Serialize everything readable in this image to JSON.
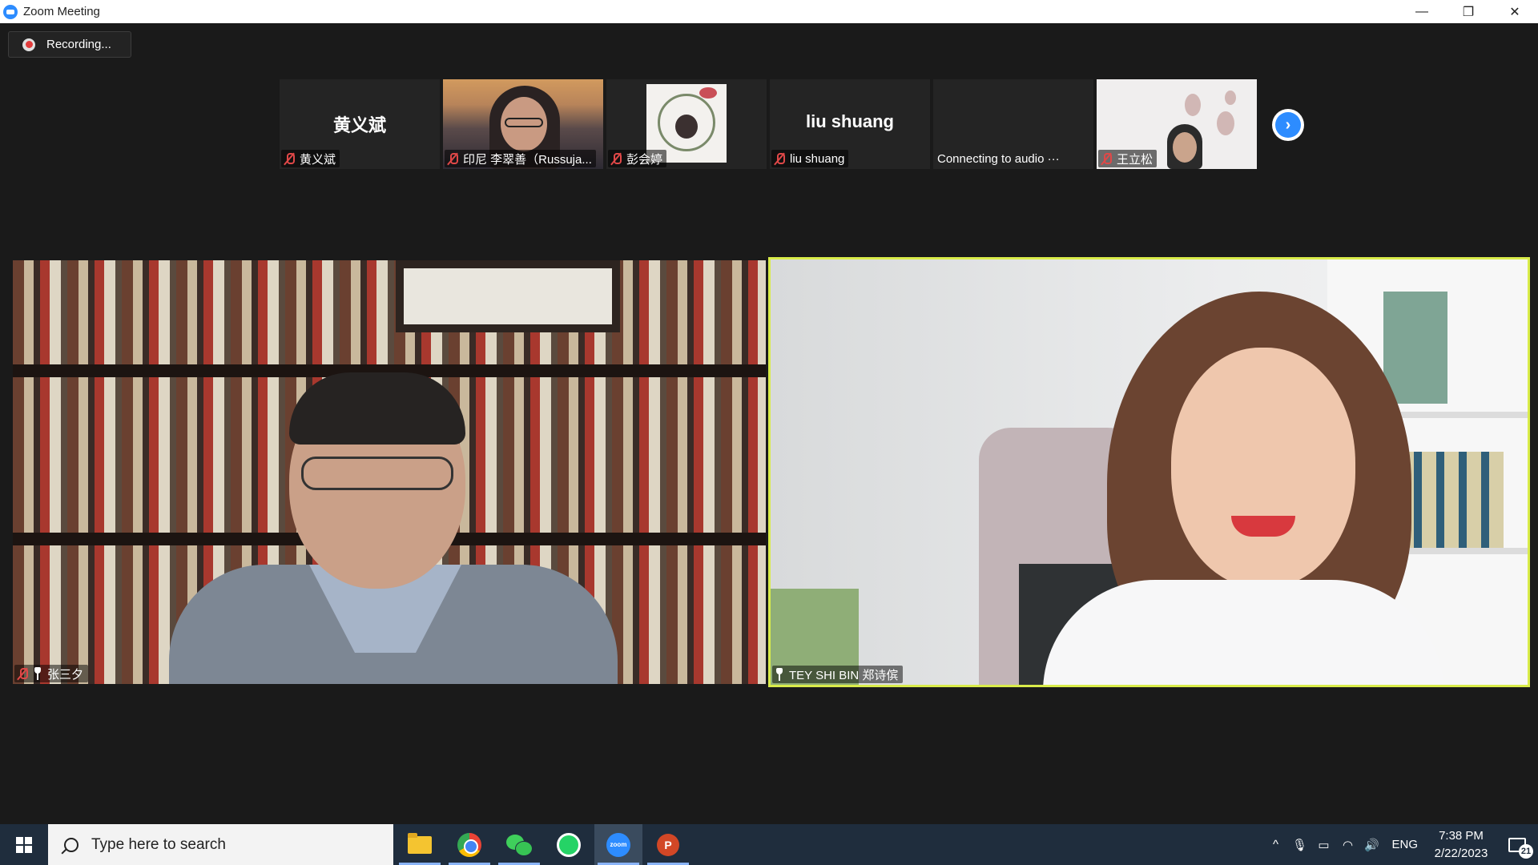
{
  "window": {
    "title": "Zoom Meeting",
    "controls": {
      "minimize": "—",
      "restore": "❐",
      "close": "✕"
    }
  },
  "recording": {
    "label": "Recording..."
  },
  "thumbnails": [
    {
      "big_name": "黄义斌",
      "label": "黄义斌",
      "muted": true,
      "type": "name"
    },
    {
      "label": "印尼 李翠善（Russuja...",
      "muted": true,
      "type": "video"
    },
    {
      "label": "彭会婷",
      "muted": true,
      "type": "avatar"
    },
    {
      "big_name": "liu shuang",
      "label": "liu shuang",
      "muted": true,
      "type": "name"
    },
    {
      "label": "Connecting to audio ···",
      "muted": false,
      "type": "connecting"
    },
    {
      "label": "王立松",
      "muted": true,
      "type": "video"
    }
  ],
  "next_page_icon": "chevron-right-icon",
  "main_videos": [
    {
      "label": "张三夕",
      "muted": true,
      "pinned": true,
      "active_speaker": false
    },
    {
      "label": "TEY SHI BIN 郑诗傧",
      "muted": false,
      "pinned": true,
      "active_speaker": true
    }
  ],
  "colors": {
    "zoom_blue": "#2d8cff",
    "active_speaker_border": "#d9ec4a",
    "muted_mic": "#e04848",
    "taskbar": "#1f2d3d"
  },
  "taskbar": {
    "search_placeholder": "Type here to search",
    "apps": [
      "File Explorer",
      "Google Chrome",
      "WeChat",
      "WhatsApp",
      "Zoom",
      "PowerPoint"
    ],
    "zoom_icon_text": "zoom",
    "ppt_icon_text": "P",
    "tray": {
      "chevron": "^",
      "language": "ENG",
      "time": "7:38 PM",
      "date": "2/22/2023",
      "notifications": "21"
    }
  }
}
